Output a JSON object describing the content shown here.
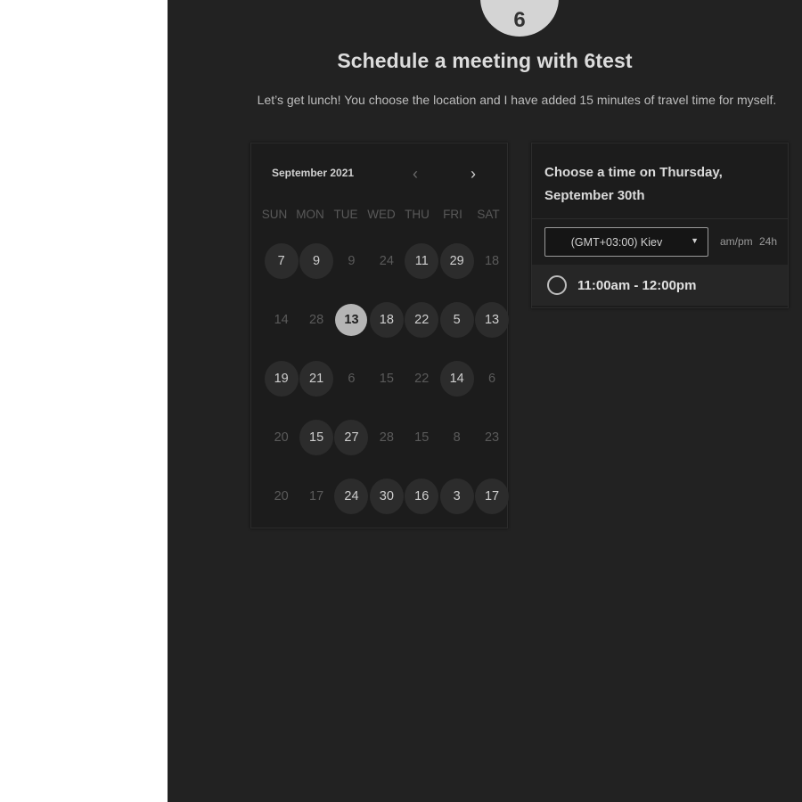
{
  "host": {
    "initial": "6",
    "title": "Schedule a meeting with 6test",
    "description": "Let’s get lunch! You choose the location and I have added 15 minutes of travel time for myself."
  },
  "calendar": {
    "month_label": "September 2021",
    "prev_icon": "chevron-left-icon",
    "next_icon": "chevron-right-icon",
    "weekdays": [
      "SUN",
      "MON",
      "TUE",
      "WED",
      "THU",
      "FRI",
      "SAT"
    ],
    "weeks": [
      [
        {
          "d": "7",
          "s": "avail"
        },
        {
          "d": "9",
          "s": "avail"
        },
        {
          "d": "9",
          "s": "off"
        },
        {
          "d": "24",
          "s": "off"
        },
        {
          "d": "11",
          "s": "avail"
        },
        {
          "d": "29",
          "s": "avail"
        },
        {
          "d": "18",
          "s": "off"
        }
      ],
      [
        {
          "d": "14",
          "s": "off"
        },
        {
          "d": "28",
          "s": "off"
        },
        {
          "d": "13",
          "s": "sel"
        },
        {
          "d": "18",
          "s": "avail"
        },
        {
          "d": "22",
          "s": "avail"
        },
        {
          "d": "5",
          "s": "avail"
        },
        {
          "d": "13",
          "s": "avail"
        }
      ],
      [
        {
          "d": "19",
          "s": "avail"
        },
        {
          "d": "21",
          "s": "avail"
        },
        {
          "d": "6",
          "s": "off"
        },
        {
          "d": "15",
          "s": "off"
        },
        {
          "d": "22",
          "s": "off"
        },
        {
          "d": "14",
          "s": "avail"
        },
        {
          "d": "6",
          "s": "off"
        }
      ],
      [
        {
          "d": "20",
          "s": "off"
        },
        {
          "d": "15",
          "s": "avail"
        },
        {
          "d": "27",
          "s": "avail"
        },
        {
          "d": "28",
          "s": "off"
        },
        {
          "d": "15",
          "s": "off"
        },
        {
          "d": "8",
          "s": "off"
        },
        {
          "d": "23",
          "s": "off"
        }
      ],
      [
        {
          "d": "20",
          "s": "off"
        },
        {
          "d": "17",
          "s": "off"
        },
        {
          "d": "24",
          "s": "avail"
        },
        {
          "d": "30",
          "s": "avail"
        },
        {
          "d": "16",
          "s": "avail"
        },
        {
          "d": "3",
          "s": "avail"
        },
        {
          "d": "17",
          "s": "avail"
        }
      ]
    ]
  },
  "time_panel": {
    "heading": "Choose a time on Thursday, September 30th",
    "timezone": "(GMT+03:00) Kiev",
    "caret_icon": "caret-down-icon",
    "format_ampm": "am/pm",
    "format_24h": "24h",
    "slots": [
      "11:00am - 12:00pm"
    ]
  },
  "colors": {
    "background": "#222222",
    "panel": "#1c1c1c",
    "selected_day": "#b5b5b5",
    "available_day": "#2c2c2c"
  }
}
